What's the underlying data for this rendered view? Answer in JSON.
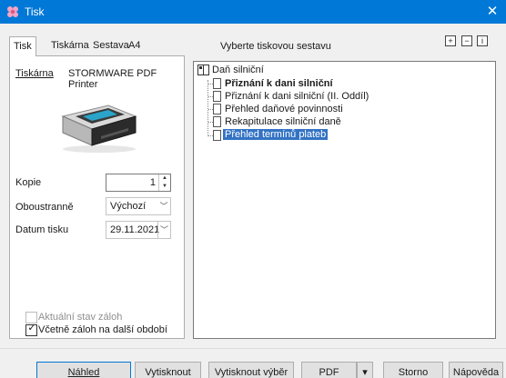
{
  "window": {
    "title": "Tisk",
    "close_glyph": "✕"
  },
  "tabs": [
    {
      "label": "Tisk",
      "active": true
    },
    {
      "label": "Tiskárna",
      "active": false
    },
    {
      "label": "Sestava",
      "active": false
    },
    {
      "label": "A4",
      "active": false
    }
  ],
  "left": {
    "printer_label": "Tiskárna",
    "printer_name": "STORMWARE PDF Printer",
    "copies_label": "Kopie",
    "copies_value": "1",
    "duplex_label": "Oboustranně",
    "duplex_value": "Výchozí",
    "date_label": "Datum tisku",
    "date_value": "29.11.2021",
    "checkbox_current_label": "Aktuální stav záloh",
    "checkbox_current_checked": false,
    "checkbox_current_disabled": true,
    "checkbox_include_label": "Včetně záloh na další období",
    "checkbox_include_checked": true
  },
  "report_header": "Vyberte tiskovou sestavu",
  "tree": {
    "root": "Daň silniční",
    "items": [
      {
        "label": "Přiznání k dani silniční",
        "bold": true,
        "selected": false
      },
      {
        "label": "Přiznání k dani silniční (II. Oddíl)",
        "bold": false,
        "selected": false
      },
      {
        "label": "Přehled daňové povinnosti",
        "bold": false,
        "selected": false
      },
      {
        "label": "Rekapitulace silniční daně",
        "bold": false,
        "selected": false
      },
      {
        "label": "Přehled termínů plateb",
        "bold": false,
        "selected": true
      }
    ]
  },
  "tree_buttons": [
    "+",
    "−",
    "i"
  ],
  "buttons": {
    "preview": "Náhled",
    "print": "Vytisknout",
    "print_selection": "Vytisknout výběr",
    "pdf": "PDF",
    "pdf_dropdown": "▾",
    "cancel": "Storno",
    "help": "Nápověda"
  },
  "icons": {
    "app": "flower-app-icon",
    "close": "close-icon",
    "printer": "printer-icon",
    "folder": "book-folder-icon",
    "document": "document-icon"
  },
  "colors": {
    "titlebar": "#0078d7",
    "selection": "#3373c4"
  }
}
